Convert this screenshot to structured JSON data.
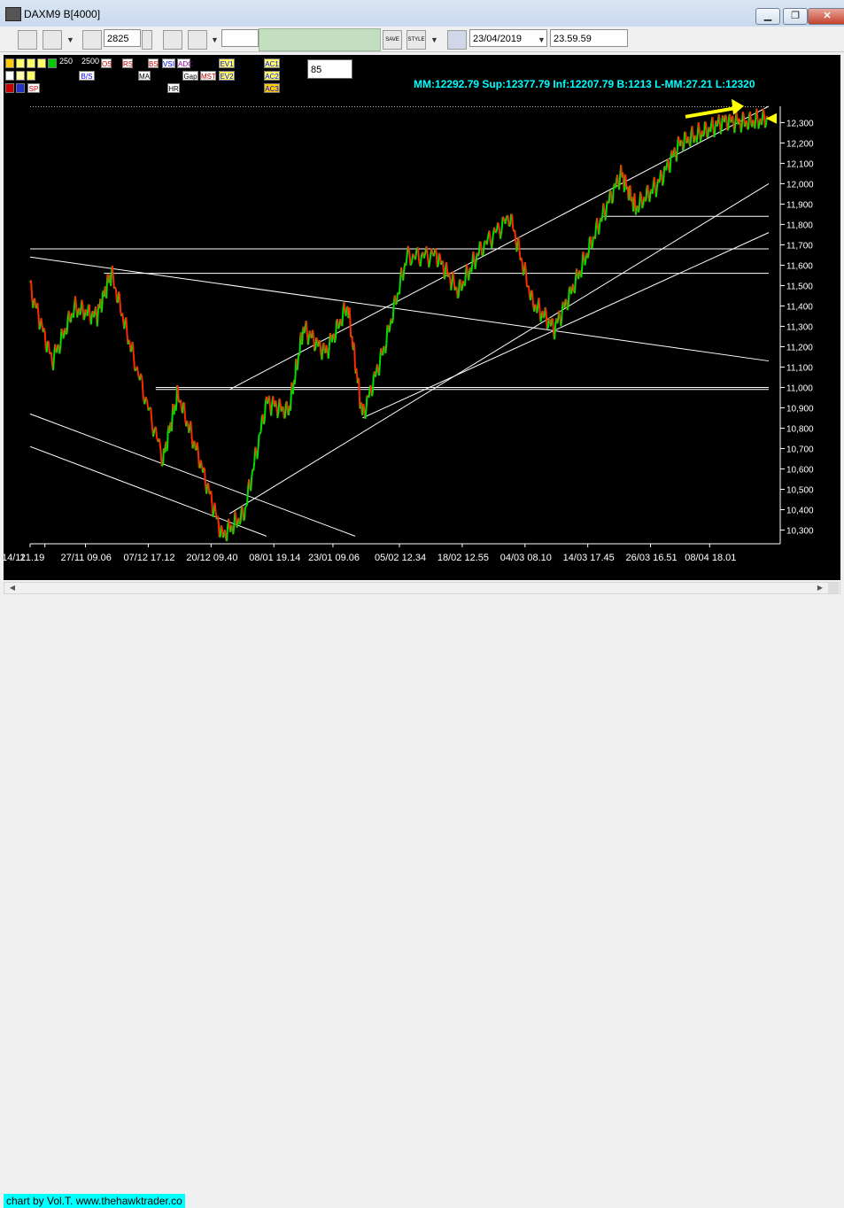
{
  "window": {
    "title": "DAXM9 B[4000]",
    "minimize": "▁",
    "restore": "❐",
    "close": "✕"
  },
  "toolbar": {
    "bars": "2825",
    "date": "23/04/2019",
    "time": "23.59.59",
    "save_label": "SAVE",
    "style_label": "STYLE"
  },
  "panel": {
    "num1": "250",
    "num2": "2500",
    "input": "85",
    "buttons": [
      "OS",
      "RS",
      "BS",
      "VSI",
      "ADC",
      "EV1",
      "EV2",
      "AC1",
      "AC2",
      "AC3",
      "B/S",
      "MA",
      "HR",
      "Gap",
      "MST",
      "SP"
    ]
  },
  "info_line": "MM:12292.79 Sup:12377.79 Inf:12207.79 B:1213 L-MM:27.21 L:12320",
  "credit": "chart by Vol.T. www.thehawktrader.co",
  "colors": {
    "background": "#000000",
    "up": "#00e000",
    "down": "#ff2a00",
    "lines": "#ffffff",
    "info": "#00ffff",
    "arrow": "#ffff00"
  },
  "chart_data": {
    "type": "line",
    "title": "",
    "xlabel": "",
    "ylabel": "",
    "ylim": [
      10250,
      12380
    ],
    "y_ticks": [
      10300,
      10400,
      10500,
      10600,
      10700,
      10800,
      10900,
      11000,
      11100,
      11200,
      11300,
      11400,
      11500,
      11600,
      11700,
      11800,
      11900,
      12000,
      12100,
      12200,
      12300
    ],
    "y_tick_labels": [
      "10,300",
      "10,400",
      "10,500",
      "10,600",
      "10,700",
      "10,800",
      "10,900",
      "11,000",
      "11,100",
      "11,200",
      "11,300",
      "11,400",
      "11,500",
      "11,600",
      "11,700",
      "11,800",
      "11,900",
      "12,000",
      "12,100",
      "12,200",
      "12,300"
    ],
    "x_tick_labels": [
      "14/11",
      "21.19",
      "27/11 09.06",
      "07/12 17.12",
      "20/12 09.40",
      "08/01 19.14",
      "23/01 09.06",
      "05/02 12.34",
      "18/02 12.55",
      "04/03 08.10",
      "14/03 17.45",
      "26/03 16.51",
      "08/04 18.01"
    ],
    "series": [
      {
        "x": [
          0,
          0.03,
          0.06,
          0.09,
          0.11,
          0.14,
          0.18,
          0.2,
          0.23,
          0.26,
          0.29,
          0.32,
          0.35,
          0.37,
          0.4,
          0.43,
          0.45,
          0.48,
          0.51,
          0.55,
          0.58,
          0.61,
          0.65,
          0.68,
          0.71,
          0.74,
          0.77,
          0.8,
          0.82,
          0.85,
          0.88,
          0.91,
          0.94,
          0.97,
          1.0
        ],
        "y": [
          11490,
          11130,
          11390,
          11350,
          11560,
          11150,
          10650,
          10970,
          10640,
          10270,
          10380,
          10930,
          10880,
          11290,
          11170,
          11400,
          10860,
          11200,
          11640,
          11650,
          11470,
          11680,
          11840,
          11420,
          11290,
          11530,
          11800,
          12050,
          11880,
          12000,
          12200,
          12250,
          12310,
          12300,
          12320
        ]
      }
    ],
    "horizontal_lines": [
      11680,
      11560,
      10990,
      11000,
      11840
    ],
    "trend_lines": [
      {
        "from": [
          0.0,
          11640
        ],
        "to": [
          1.0,
          11130
        ]
      },
      {
        "from": [
          0.0,
          10870
        ],
        "to": [
          0.44,
          10270
        ]
      },
      {
        "from": [
          0.0,
          10710
        ],
        "to": [
          0.32,
          10270
        ]
      },
      {
        "from": [
          0.27,
          10990
        ],
        "to": [
          1.0,
          12380
        ]
      },
      {
        "from": [
          0.27,
          10380
        ],
        "to": [
          1.0,
          12000
        ]
      },
      {
        "from": [
          0.45,
          10850
        ],
        "to": [
          1.0,
          11760
        ]
      }
    ],
    "reference_level": 12377.79,
    "last_value": 12320
  }
}
